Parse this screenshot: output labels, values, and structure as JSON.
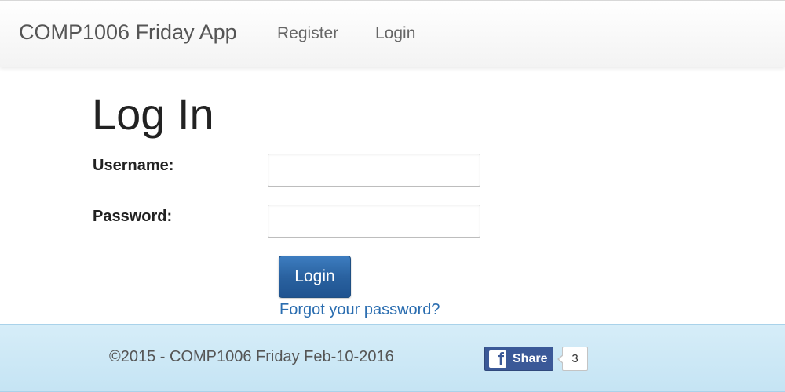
{
  "navbar": {
    "brand": "COMP1006 Friday App",
    "links": [
      {
        "label": "Register"
      },
      {
        "label": "Login"
      }
    ]
  },
  "main": {
    "title": "Log In",
    "username_label": "Username:",
    "username_value": "",
    "password_label": "Password:",
    "password_value": "",
    "login_button": "Login",
    "forgot_link": "Forgot your password?"
  },
  "footer": {
    "text": "©2015 - COMP1006 Friday Feb-10-2016",
    "share": {
      "icon": "facebook-icon",
      "label": "Share",
      "count": "3"
    }
  },
  "colors": {
    "primary_button": "#2a62a0",
    "link": "#2a6db0",
    "footer_bg": "#cfe9f6",
    "facebook": "#3b5998"
  }
}
